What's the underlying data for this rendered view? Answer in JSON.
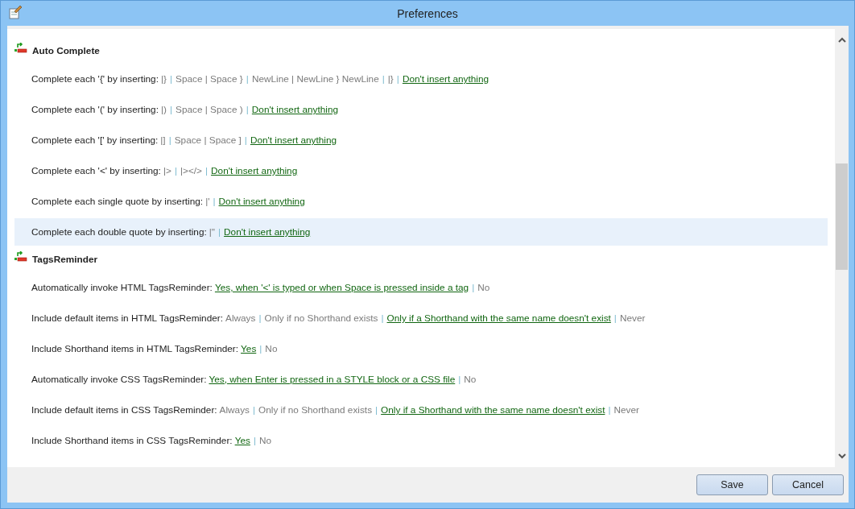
{
  "window": {
    "title": "Preferences"
  },
  "separator": "|",
  "sections": [
    {
      "title": "Auto Complete",
      "settings": [
        {
          "label": "Complete each '{' by inserting:",
          "highlighted": false,
          "options": [
            {
              "text": "|}",
              "selected": false
            },
            {
              "text": "Space | Space }",
              "selected": false
            },
            {
              "text": "NewLine | NewLine } NewLine",
              "selected": false
            },
            {
              "text": "|}",
              "selected": false
            },
            {
              "text": "Don't insert anything",
              "selected": true
            }
          ]
        },
        {
          "label": "Complete each '(' by inserting:",
          "highlighted": false,
          "options": [
            {
              "text": "|)",
              "selected": false
            },
            {
              "text": "Space | Space )",
              "selected": false
            },
            {
              "text": "Don't insert anything",
              "selected": true
            }
          ]
        },
        {
          "label": "Complete each '[' by inserting:",
          "highlighted": false,
          "options": [
            {
              "text": "|]",
              "selected": false
            },
            {
              "text": "Space | Space ]",
              "selected": false
            },
            {
              "text": "Don't insert anything",
              "selected": true
            }
          ]
        },
        {
          "label": "Complete each '<' by inserting:",
          "highlighted": false,
          "options": [
            {
              "text": "|>",
              "selected": false
            },
            {
              "text": "|></>",
              "selected": false
            },
            {
              "text": "Don't insert anything",
              "selected": true
            }
          ]
        },
        {
          "label": "Complete each single quote by inserting:",
          "highlighted": false,
          "options": [
            {
              "text": "|'",
              "selected": false
            },
            {
              "text": "Don't insert anything",
              "selected": true
            }
          ]
        },
        {
          "label": "Complete each double quote by inserting:",
          "highlighted": true,
          "options": [
            {
              "text": "|\"",
              "selected": false
            },
            {
              "text": "Don't insert anything",
              "selected": true
            }
          ]
        }
      ]
    },
    {
      "title": "TagsReminder",
      "settings": [
        {
          "label": "Automatically invoke HTML TagsReminder:",
          "highlighted": false,
          "options": [
            {
              "text": "Yes, when '<' is typed or when Space is pressed inside a tag",
              "selected": true
            },
            {
              "text": "No",
              "selected": false
            }
          ]
        },
        {
          "label": "Include default items in HTML TagsReminder:",
          "highlighted": false,
          "options": [
            {
              "text": "Always",
              "selected": false
            },
            {
              "text": "Only if no Shorthand exists",
              "selected": false
            },
            {
              "text": "Only if a Shorthand with the same name doesn't exist",
              "selected": true
            },
            {
              "text": "Never",
              "selected": false
            }
          ]
        },
        {
          "label": "Include Shorthand items in HTML TagsReminder:",
          "highlighted": false,
          "options": [
            {
              "text": "Yes",
              "selected": true
            },
            {
              "text": "No",
              "selected": false
            }
          ]
        },
        {
          "label": "Automatically invoke CSS TagsReminder:",
          "highlighted": false,
          "options": [
            {
              "text": "Yes, when Enter is pressed in a STYLE block or a CSS file",
              "selected": true
            },
            {
              "text": "No",
              "selected": false
            }
          ]
        },
        {
          "label": "Include default items in CSS TagsReminder:",
          "highlighted": false,
          "options": [
            {
              "text": "Always",
              "selected": false
            },
            {
              "text": "Only if no Shorthand exists",
              "selected": false
            },
            {
              "text": "Only if a Shorthand with the same name doesn't exist",
              "selected": true
            },
            {
              "text": "Never",
              "selected": false
            }
          ]
        },
        {
          "label": "Include Shorthand items in CSS TagsReminder:",
          "highlighted": false,
          "options": [
            {
              "text": "Yes",
              "selected": true
            },
            {
              "text": "No",
              "selected": false
            }
          ]
        }
      ]
    }
  ],
  "buttons": [
    "Save",
    "Cancel"
  ]
}
